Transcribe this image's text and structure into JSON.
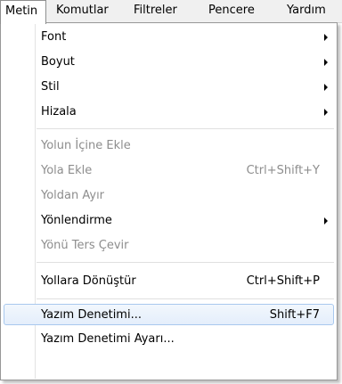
{
  "menubar": {
    "items": [
      {
        "label": "Metin"
      },
      {
        "label": "Komutlar"
      },
      {
        "label": "Filtreler"
      },
      {
        "label": "Pencere"
      },
      {
        "label": "Yardım"
      }
    ]
  },
  "menu": {
    "items": [
      {
        "label": "Font",
        "shortcut": "",
        "submenu": true,
        "enabled": true
      },
      {
        "label": "Boyut",
        "shortcut": "",
        "submenu": true,
        "enabled": true
      },
      {
        "label": "Stil",
        "shortcut": "",
        "submenu": true,
        "enabled": true
      },
      {
        "label": "Hizala",
        "shortcut": "",
        "submenu": true,
        "enabled": true
      },
      {
        "label": "Yolun İçine Ekle",
        "shortcut": "",
        "submenu": false,
        "enabled": false
      },
      {
        "label": "Yola Ekle",
        "shortcut": "Ctrl+Shift+Y",
        "submenu": false,
        "enabled": false
      },
      {
        "label": "Yoldan Ayır",
        "shortcut": "",
        "submenu": false,
        "enabled": false
      },
      {
        "label": "Yönlendirme",
        "shortcut": "",
        "submenu": true,
        "enabled": true
      },
      {
        "label": "Yönü Ters Çevir",
        "shortcut": "",
        "submenu": false,
        "enabled": false
      },
      {
        "label": "Yollara Dönüştür",
        "shortcut": "Ctrl+Shift+P",
        "submenu": false,
        "enabled": true
      },
      {
        "label": "Yazım Denetimi...",
        "shortcut": "Shift+F7",
        "submenu": false,
        "enabled": true,
        "highlighted": true
      },
      {
        "label": "Yazım Denetimi Ayarı...",
        "shortcut": "",
        "submenu": false,
        "enabled": true
      }
    ]
  },
  "colors": {
    "highlight_border": "#a8c8ee",
    "disabled_text": "#8d8d8d",
    "menubar_bg": "#f0f0f0"
  }
}
